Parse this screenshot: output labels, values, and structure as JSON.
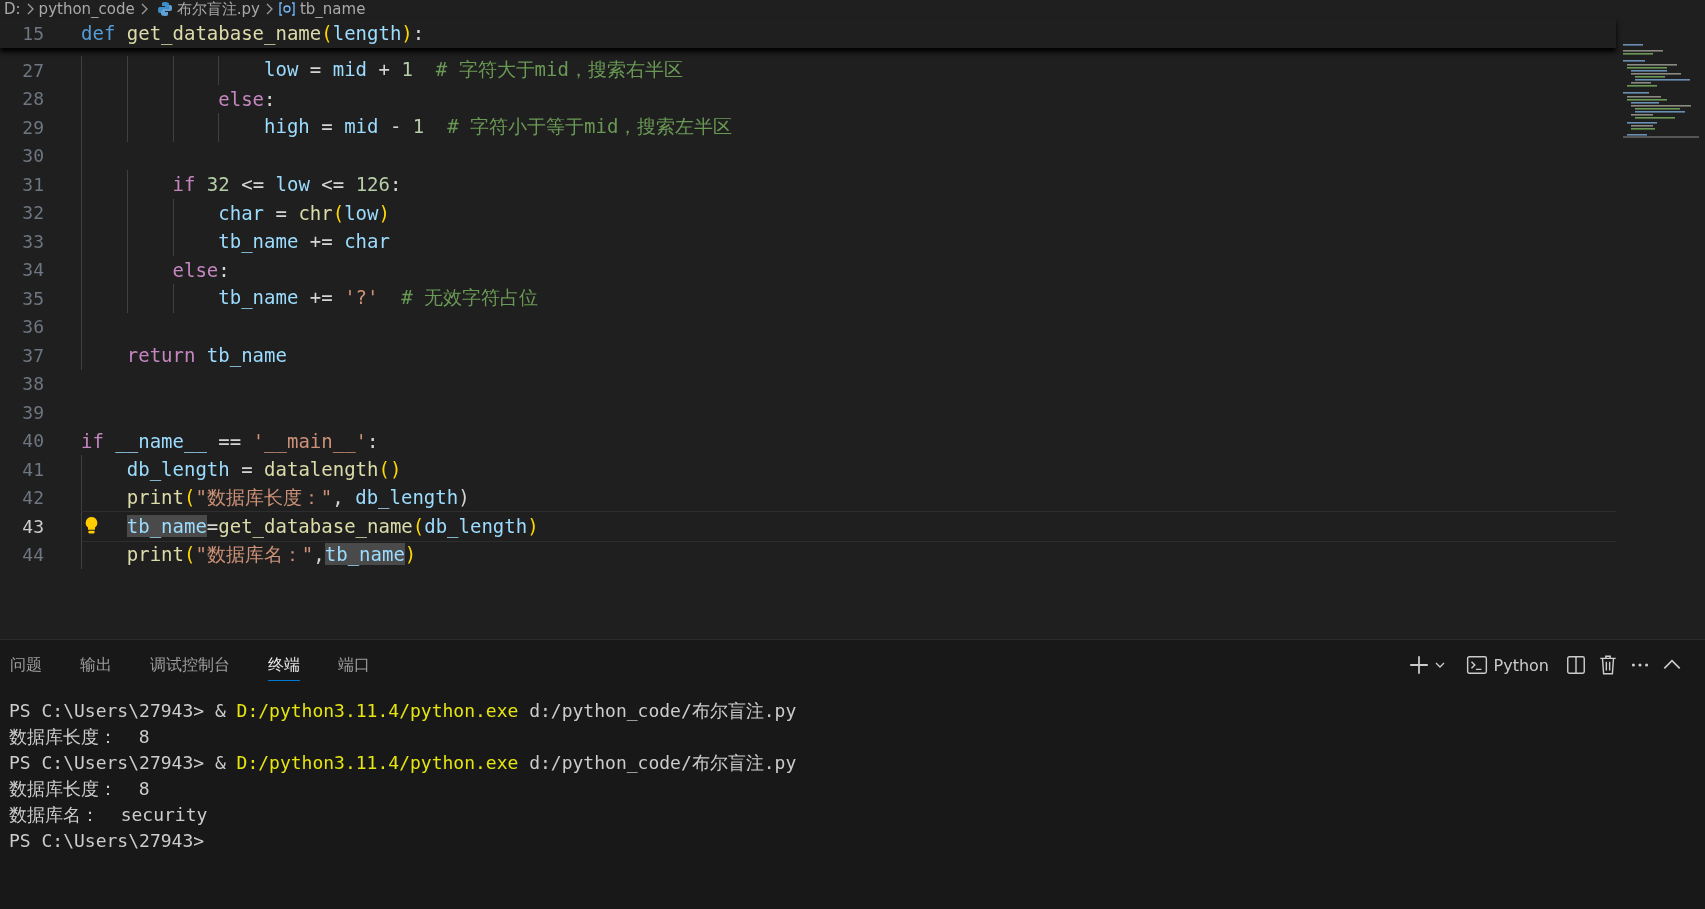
{
  "breadcrumb": {
    "drive": "D:",
    "folder": "python_code",
    "file": "布尔盲注.py",
    "symbol": "tb_name"
  },
  "sticky_line": {
    "number": "15",
    "tokens": [
      {
        "kind": "def",
        "text": "def "
      },
      {
        "kind": "func",
        "text": "get_database_name"
      },
      {
        "kind": "bracket",
        "text": "("
      },
      {
        "kind": "var",
        "text": "length"
      },
      {
        "kind": "bracket",
        "text": ")"
      },
      {
        "kind": "plain",
        "text": ":"
      }
    ]
  },
  "lines": [
    {
      "number": "27",
      "current": false,
      "tokens": [
        {
          "kind": "var",
          "text": "                low"
        },
        {
          "kind": "plain",
          "text": " = "
        },
        {
          "kind": "var",
          "text": "mid"
        },
        {
          "kind": "plain",
          "text": " + "
        },
        {
          "kind": "number",
          "text": "1"
        },
        {
          "kind": "comment",
          "text": "  # 字符大于mid，搜索右半区"
        }
      ]
    },
    {
      "number": "28",
      "current": false,
      "tokens": [
        {
          "kind": "keyword",
          "text": "            else"
        },
        {
          "kind": "plain",
          "text": ":"
        }
      ]
    },
    {
      "number": "29",
      "current": false,
      "tokens": [
        {
          "kind": "var",
          "text": "                high"
        },
        {
          "kind": "plain",
          "text": " = "
        },
        {
          "kind": "var",
          "text": "mid"
        },
        {
          "kind": "plain",
          "text": " - "
        },
        {
          "kind": "number",
          "text": "1"
        },
        {
          "kind": "comment",
          "text": "  # 字符小于等于mid，搜索左半区"
        }
      ]
    },
    {
      "number": "30",
      "current": false,
      "indent_guide": true
    },
    {
      "number": "31",
      "current": false,
      "tokens": [
        {
          "kind": "keyword",
          "text": "        if "
        },
        {
          "kind": "number",
          "text": "32"
        },
        {
          "kind": "plain",
          "text": " <= "
        },
        {
          "kind": "var",
          "text": "low"
        },
        {
          "kind": "plain",
          "text": " <= "
        },
        {
          "kind": "number",
          "text": "126"
        },
        {
          "kind": "plain",
          "text": ":"
        }
      ]
    },
    {
      "number": "32",
      "current": false,
      "tokens": [
        {
          "kind": "var",
          "text": "            char"
        },
        {
          "kind": "plain",
          "text": " = "
        },
        {
          "kind": "func",
          "text": "chr"
        },
        {
          "kind": "bracket",
          "text": "("
        },
        {
          "kind": "var",
          "text": "low"
        },
        {
          "kind": "bracket",
          "text": ")"
        }
      ]
    },
    {
      "number": "33",
      "current": false,
      "tokens": [
        {
          "kind": "var",
          "text": "            tb_name"
        },
        {
          "kind": "plain",
          "text": " += "
        },
        {
          "kind": "var",
          "text": "char"
        }
      ]
    },
    {
      "number": "34",
      "current": false,
      "tokens": [
        {
          "kind": "keyword",
          "text": "        else"
        },
        {
          "kind": "plain",
          "text": ":"
        }
      ]
    },
    {
      "number": "35",
      "current": false,
      "tokens": [
        {
          "kind": "var",
          "text": "            tb_name"
        },
        {
          "kind": "plain",
          "text": " += "
        },
        {
          "kind": "string",
          "text": "'?'"
        },
        {
          "kind": "comment",
          "text": "  # 无效字符占位"
        }
      ]
    },
    {
      "number": "36",
      "current": false,
      "indent_guide": true
    },
    {
      "number": "37",
      "current": false,
      "tokens": [
        {
          "kind": "keyword",
          "text": "    return "
        },
        {
          "kind": "var",
          "text": "tb_name"
        }
      ]
    },
    {
      "number": "38",
      "current": false,
      "indent_guide": false
    },
    {
      "number": "39",
      "current": false,
      "indent_guide": false
    },
    {
      "number": "40",
      "current": false,
      "tokens": [
        {
          "kind": "keyword",
          "text": "if "
        },
        {
          "kind": "var",
          "text": "__name__"
        },
        {
          "kind": "plain",
          "text": " == "
        },
        {
          "kind": "string",
          "text": "'__main__'"
        },
        {
          "kind": "plain",
          "text": ":"
        }
      ]
    },
    {
      "number": "41",
      "current": false,
      "tokens": [
        {
          "kind": "var",
          "text": "    db_length"
        },
        {
          "kind": "plain",
          "text": " = "
        },
        {
          "kind": "func",
          "text": "datalength"
        },
        {
          "kind": "bracket",
          "text": "()"
        }
      ]
    },
    {
      "number": "42",
      "current": false,
      "tokens": [
        {
          "kind": "func",
          "text": "    print"
        },
        {
          "kind": "bracket",
          "text": "("
        },
        {
          "kind": "string",
          "text": "\"数据库长度：\""
        },
        {
          "kind": "plain",
          "text": ", "
        },
        {
          "kind": "var",
          "text": "db_length"
        },
        {
          "kind": "plain",
          "text": ")"
        }
      ]
    },
    {
      "number": "43",
      "current": true,
      "lightbulb": true,
      "tokens": [
        {
          "kind": "match",
          "text": "    tb_name"
        },
        {
          "kind": "plain",
          "text": "="
        },
        {
          "kind": "func",
          "text": "get_database_name"
        },
        {
          "kind": "bracket",
          "text": "("
        },
        {
          "kind": "var",
          "text": "db_length"
        },
        {
          "kind": "bracket",
          "text": ")"
        }
      ]
    },
    {
      "number": "44",
      "current": false,
      "tokens": [
        {
          "kind": "func",
          "text": "    print"
        },
        {
          "kind": "bracket",
          "text": "("
        },
        {
          "kind": "string",
          "text": "\"数据库名：\""
        },
        {
          "kind": "plain",
          "text": ","
        },
        {
          "kind": "match",
          "text": "tb_name"
        },
        {
          "kind": "bracket",
          "text": ")"
        }
      ]
    }
  ],
  "panel_tabs": [
    {
      "label": "问题",
      "selected": false
    },
    {
      "label": "输出",
      "selected": false
    },
    {
      "label": "调试控制台",
      "selected": false
    },
    {
      "label": "终端",
      "selected": true
    },
    {
      "label": "端口",
      "selected": false
    }
  ],
  "terminal_profile": "Python",
  "terminal_lines": [
    [
      {
        "kind": "plain",
        "text": "PS C:\\Users\\27943> & "
      },
      {
        "kind": "exe",
        "text": "D:/python3.11.4/python.exe"
      },
      {
        "kind": "plain",
        "text": " d:/python_code/布尔盲注.py"
      }
    ],
    [
      {
        "kind": "plain",
        "text": "数据库长度：  8"
      }
    ],
    [
      {
        "kind": "plain",
        "text": "PS C:\\Users\\27943> & "
      },
      {
        "kind": "exe",
        "text": "D:/python3.11.4/python.exe"
      },
      {
        "kind": "plain",
        "text": " d:/python_code/布尔盲注.py"
      }
    ],
    [
      {
        "kind": "plain",
        "text": "数据库长度：  8"
      }
    ],
    [
      {
        "kind": "plain",
        "text": "数据库名：  security"
      }
    ],
    [
      {
        "kind": "plain",
        "text": "PS C:\\Users\\27943>"
      }
    ]
  ]
}
